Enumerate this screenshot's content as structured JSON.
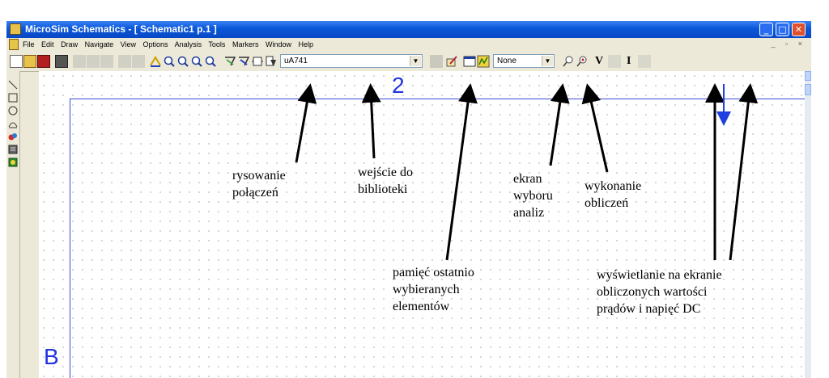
{
  "window": {
    "title": "MicroSim Schematics - [ Schematic1  p.1  ]",
    "min_glyph": "_",
    "max_glyph": "□",
    "close_glyph": "✕"
  },
  "menu": {
    "items": [
      "File",
      "Edit",
      "Draw",
      "Navigate",
      "View",
      "Options",
      "Analysis",
      "Tools",
      "Markers",
      "Window",
      "Help"
    ],
    "right_controls": "_ ▫ ×"
  },
  "toolbar": {
    "part_combo": "uA741",
    "setup_combo": "None",
    "voltage_label": "V",
    "current_label": "I"
  },
  "canvas": {
    "zone_2": "2",
    "zone_B": "B"
  },
  "annotations": {
    "draw_wire": [
      "rysowanie",
      "połączeń"
    ],
    "get_part": [
      "wejście do",
      "biblioteki"
    ],
    "analysis_setup": [
      "ekran",
      "wyboru",
      "analiz"
    ],
    "simulate": [
      "wykonanie",
      "obliczeń"
    ],
    "recent_parts": [
      "pamięć ostatnio",
      "wybieranych",
      "elementów"
    ],
    "bias_display": [
      "wyświetlanie na ekranie",
      "obliczonych wartości",
      "prądów i napięć DC"
    ]
  },
  "colors": {
    "titlebar": "#0a58d8",
    "chrome": "#ece9d8",
    "sheet_border": "#3b49d8",
    "marker": "#1f3fe0"
  }
}
